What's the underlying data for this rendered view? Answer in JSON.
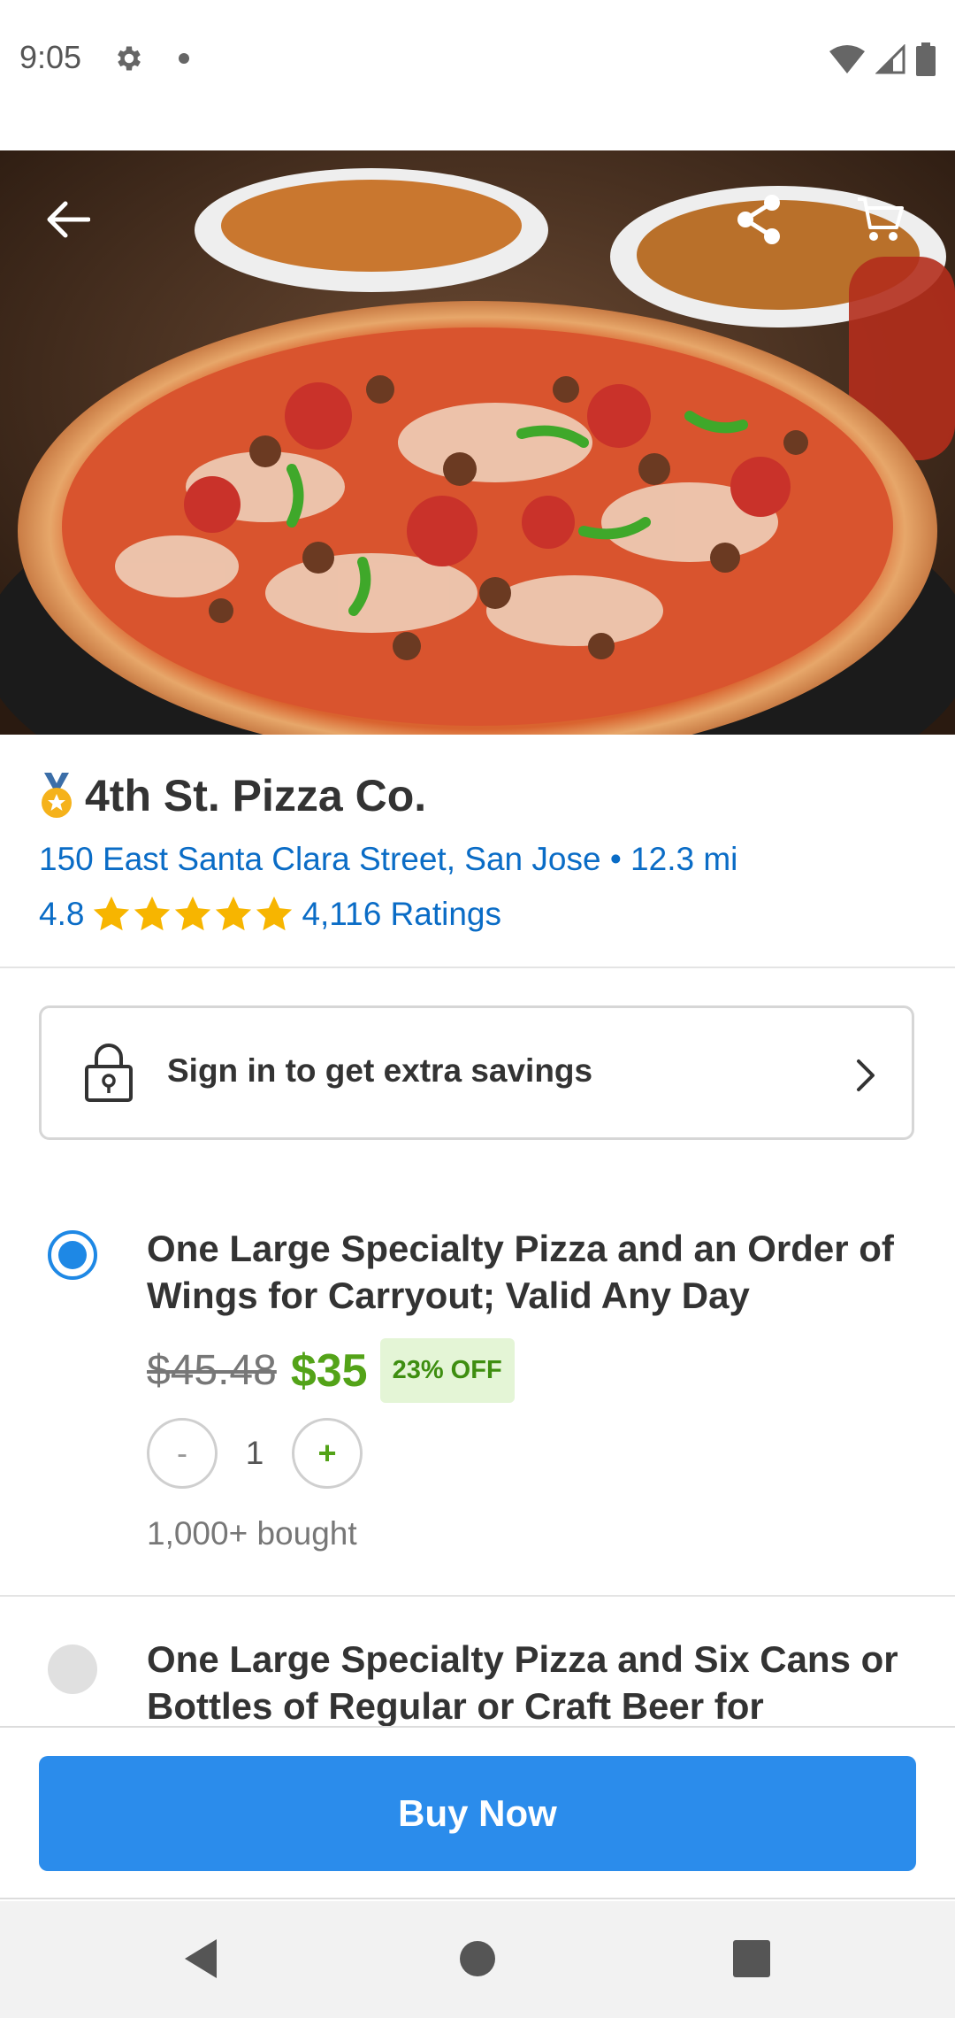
{
  "status_bar": {
    "time": "9:05",
    "icons": [
      "gear-icon",
      "notification-dot-icon",
      "wifi-icon",
      "cell-signal-icon",
      "battery-icon"
    ]
  },
  "hero": {
    "image_description_icon": "pizza-photo",
    "actions": [
      "back-arrow-icon",
      "share-icon",
      "cart-icon"
    ]
  },
  "merchant": {
    "name": "4th St. Pizza Co.",
    "badge_icon": "medal-icon",
    "address": "150 East Santa Clara Street, San Jose • 12.3 mi",
    "rating": "4.8",
    "stars": 5,
    "ratings_count": "4,116 Ratings"
  },
  "signin": {
    "label": "Sign in to get extra savings",
    "icon": "lock-icon"
  },
  "options": [
    {
      "selected": true,
      "title": "One Large Specialty Pizza and an Order of Wings for Carryout; Valid Any Day",
      "old_price": "$45.48",
      "new_price": "$35",
      "discount": "23% OFF",
      "qty_minus": "-",
      "quantity": "1",
      "qty_plus": "+",
      "bought": "1,000+ bought"
    },
    {
      "selected": false,
      "title": "One Large Specialty Pizza and Six Cans or Bottles of Regular or Craft Beer for"
    }
  ],
  "buy_button": {
    "label": "Buy Now"
  },
  "colors": {
    "link_blue": "#0a6cc6",
    "primary_blue": "#2b8ceb",
    "price_green": "#53a318",
    "star_yellow": "#f7b500"
  },
  "nav_bar": [
    "nav-back-icon",
    "nav-home-icon",
    "nav-recents-icon"
  ]
}
